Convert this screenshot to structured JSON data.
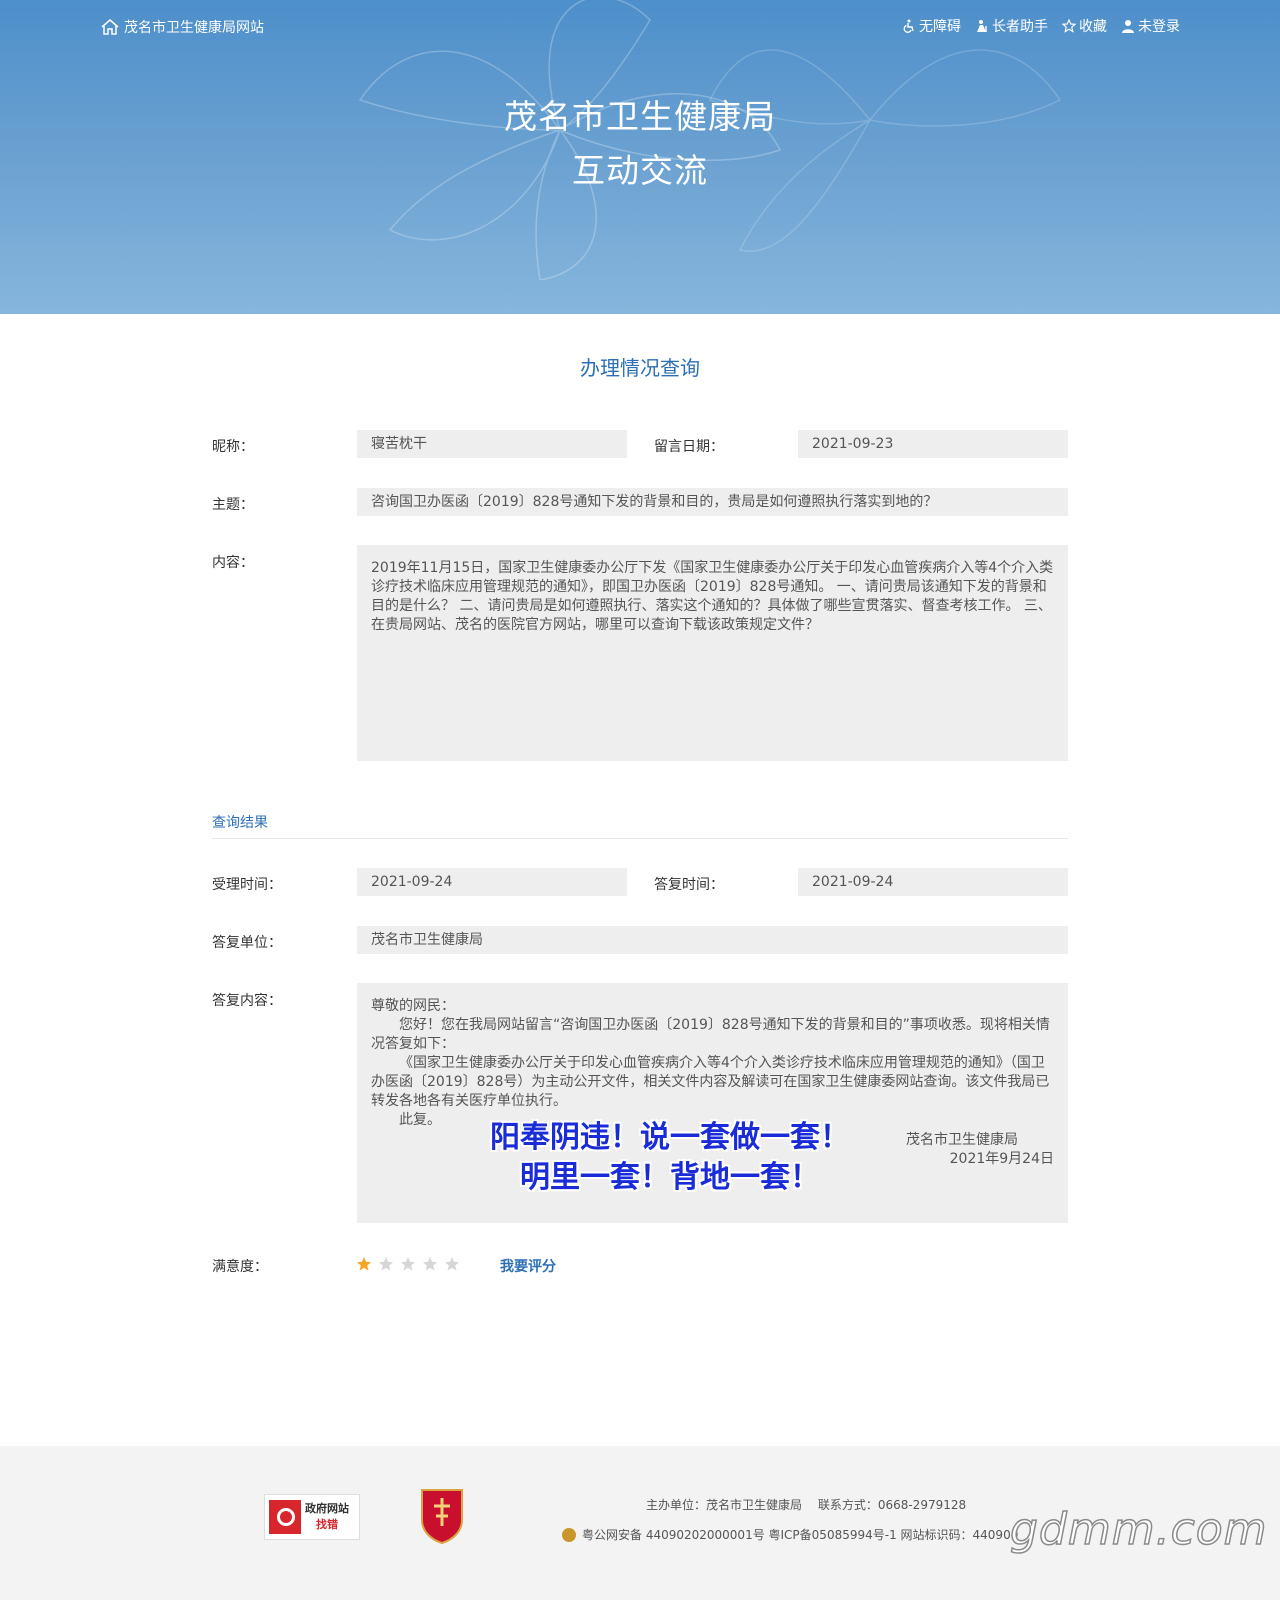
{
  "header": {
    "site_link": "茂名市卫生健康局网站",
    "tools": [
      {
        "icon": "wheelchair-icon",
        "label": "无障碍"
      },
      {
        "icon": "elder-helper-icon",
        "label": "长者助手"
      },
      {
        "icon": "star-outline-icon",
        "label": "收藏"
      },
      {
        "icon": "user-icon",
        "label": "未登录"
      }
    ],
    "title_line1": "茂名市卫生健康局",
    "title_line2": "互动交流"
  },
  "main": {
    "section_title": "办理情况查询",
    "nickname_label": "昵称：",
    "nickname": "寝苦枕干",
    "date_label": "留言日期：",
    "date": "2021-09-23",
    "subject_label": "主题：",
    "subject": "咨询国卫办医函〔2019〕828号通知下发的背景和目的，贵局是如何遵照执行落实到地的？",
    "content_label": "内容：",
    "content": "2019年11月15日，国家卫生健康委办公厅下发《国家卫生健康委办公厅关于印发心血管疾病介入等4个介入类诊疗技术临床应用管理规范的通知》，即国卫办医函〔2019〕828号通知。 一、请问贵局该通知下发的背景和目的是什么？ 二、请问贵局是如何遵照执行、落实这个通知的？具体做了哪些宣贯落实、督查考核工作。 三、在贵局网站、茂名的医院官方网站，哪里可以查询下载该政策规定文件？"
  },
  "result": {
    "heading": "查询结果",
    "accept_label": "受理时间：",
    "accept_time": "2021-09-24",
    "reply_time_label": "答复时间：",
    "reply_time": "2021-09-24",
    "unit_label": "答复单位：",
    "unit": "茂名市卫生健康局",
    "reply_label": "答复内容：",
    "reply_greeting": "尊敬的网民：",
    "reply_p1": "您好！您在我局网站留言“咨询国卫办医函〔2019〕828号通知下发的背景和目的”事项收悉。现将相关情况答复如下：",
    "reply_p2": "《国家卫生健康委办公厅关于印发心血管疾病介入等4个介入类诊疗技术临床应用管理规范的通知》（国卫办医函〔2019〕828号）为主动公开文件，相关文件内容及解读可在国家卫生健康委网站查询。该文件我局已转发各地各有关医疗单位执行。",
    "reply_p3": "此复。",
    "reply_sign_unit": "茂名市卫生健康局",
    "reply_sign_date": "2021年9月24日",
    "slogan_line1": "阳奉阴违！说一套做一套！",
    "slogan_line2": "明里一套！背地一套！",
    "satisfaction_label": "满意度：",
    "rating": 1,
    "rating_max": 5,
    "rate_button": "我要评分",
    "star_color_on": "#f5a623",
    "star_color_off": "#d6d6d6"
  },
  "footer": {
    "err_badge_line1": "政府网站",
    "err_badge_line2": "找错",
    "line1": "主办单位：茂名市卫生健康局　 联系方式：0668-2979128",
    "line2": "粤公网安备 44090202000001号 粤ICP备05085994号-1 网站标识码：440900",
    "watermark": "gdmm.com"
  }
}
